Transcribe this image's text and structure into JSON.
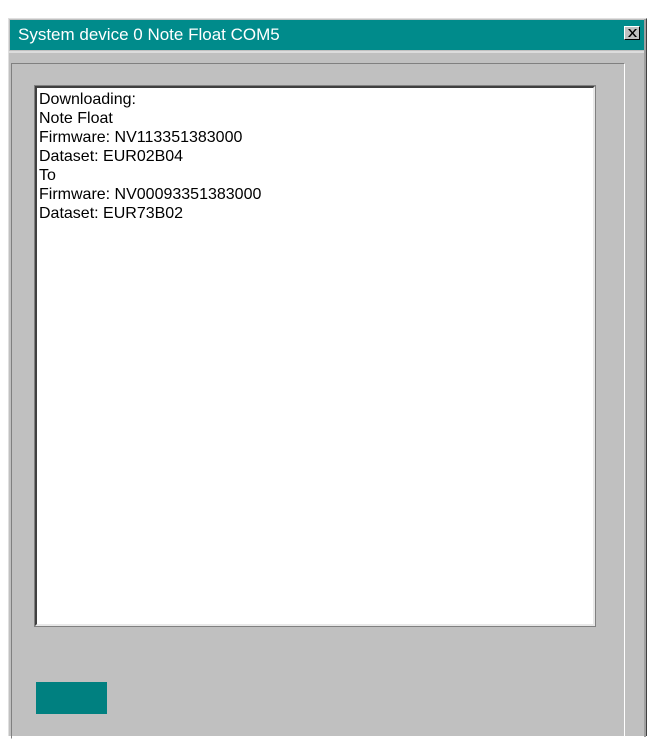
{
  "window": {
    "title": "System device 0 Note Float COM5",
    "accent_color": "#008b8b",
    "close_icon": "close-icon"
  },
  "log": {
    "lines": [
      "Downloading:",
      "Note Float",
      "Firmware: NV113351383000",
      "Dataset: EUR02B04",
      "To",
      "Firmware: NV00093351383000",
      "Dataset: EUR73B02"
    ]
  },
  "action_button": {
    "color": "#008080"
  }
}
